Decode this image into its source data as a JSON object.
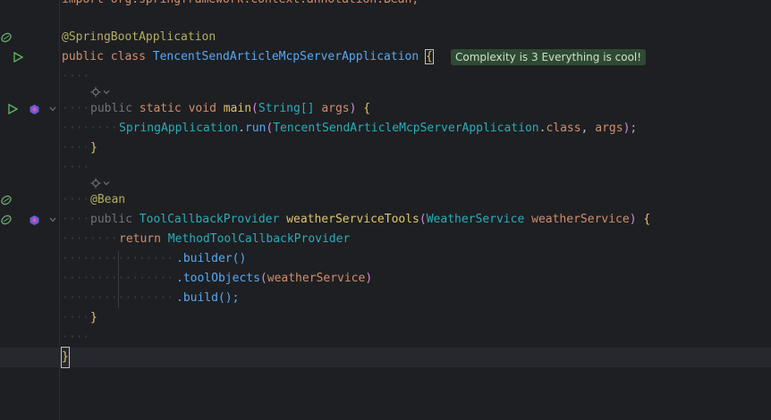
{
  "editor": {
    "lines": {
      "import": "import org.springframework.context.annotation.Bean;",
      "annotation": "@SpringBootApplication",
      "class_public": "public",
      "class_kw": "class",
      "class_name": "TencentSendArticleMcpServerApplication",
      "class_open": "{",
      "hint": "Complexity is 3 Everything is cool!",
      "main_public": "public",
      "main_static": "static",
      "main_void": "void",
      "main_name": "main",
      "main_paren_open": "(",
      "main_param_type": "String[]",
      "main_param_name": "args",
      "main_paren_close": ")",
      "main_open": "{",
      "run_obj": "SpringApplication",
      "run_dot": ".",
      "run_method": "run",
      "run_paren_open": "(",
      "run_class": "TencentSendArticleMcpServerApplication",
      "run_dot_class": ".",
      "run_class_kw": "class",
      "run_comma": ", ",
      "run_arg": "args",
      "run_paren_close": ");",
      "main_close": "}",
      "bean": "@Bean",
      "tools_public": "public",
      "tools_type": "ToolCallbackProvider",
      "tools_name": "weatherServiceTools",
      "tools_paren_open": "(",
      "tools_param_type": "WeatherService",
      "tools_param_name": "weatherService",
      "tools_paren_close": ")",
      "tools_open": "{",
      "return_kw": "return",
      "return_obj": "MethodToolCallbackProvider",
      "builder": ".builder()",
      "toolobjects_method": ".toolObjects",
      "toolobjects_paren_open": "(",
      "toolobjects_arg": "weatherService",
      "toolobjects_paren_close": ")",
      "build": ".build();",
      "tools_close": "}",
      "class_close": "}"
    },
    "colors": {
      "background": "#1e1f22",
      "keyword": "#cf8e6d",
      "annotation": "#b3ae60",
      "method": "#56a8f5",
      "type": "#2aacb8",
      "hint_bg": "#2e4a33"
    },
    "icons": {
      "run": "run-icon",
      "bean": "bean-icon",
      "implementation": "implementation-icon",
      "fold": "fold-chevron-icon"
    }
  }
}
